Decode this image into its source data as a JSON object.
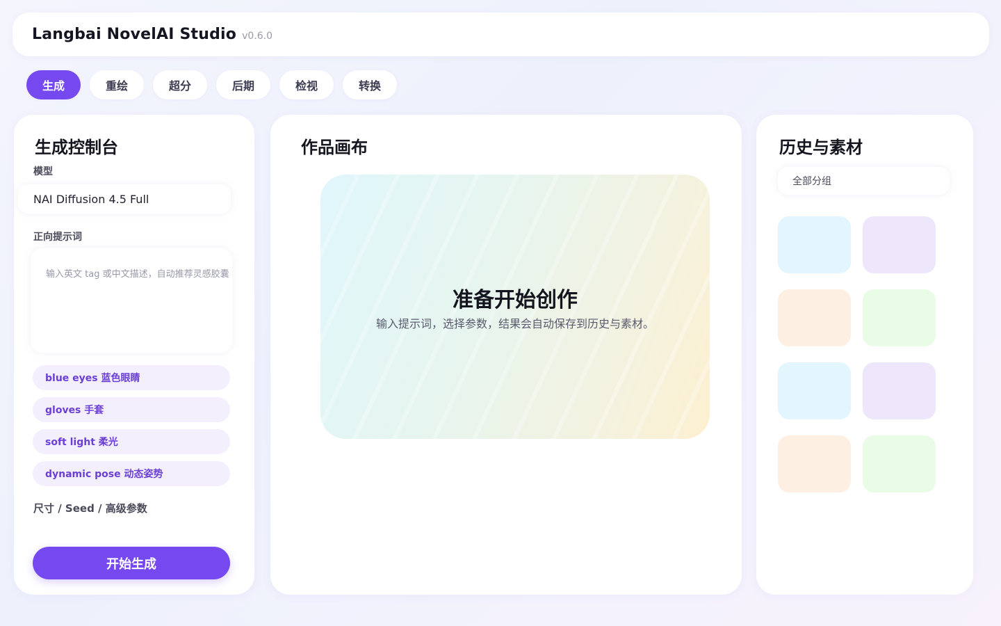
{
  "header": {
    "title": "Langbai NovelAI Studio",
    "version": "v0.6.0"
  },
  "tabs": [
    {
      "label": "生成",
      "active": true
    },
    {
      "label": "重绘"
    },
    {
      "label": "超分"
    },
    {
      "label": "后期"
    },
    {
      "label": "检视"
    },
    {
      "label": "转换"
    }
  ],
  "control": {
    "title": "生成控制台",
    "model_label": "模型",
    "model_value": "NAI Diffusion 4.5 Full",
    "prompt_label": "正向提示词",
    "prompt_placeholder": "输入英文 tag 或中文描述，自动推荐灵感胶囊",
    "chips": [
      "blue  eyes 蓝色眼睛",
      "gloves 手套",
      "soft  light 柔光",
      "dynamic  pose 动态姿势"
    ],
    "advanced_label": "尺寸 / Seed / 高级参数",
    "generate_label": "开始生成"
  },
  "canvas": {
    "title": "作品画布",
    "heading": "准备开始创作",
    "subtitle": "输入提示词，选择参数，结果会自动保存到历史与素材。"
  },
  "history": {
    "title": "历史与素材",
    "group_value": "全部分组",
    "thumb_colors": [
      "#e3f6fd",
      "#eee7fc",
      "#fdf0e3",
      "#e9fce6",
      "#e3f6fd",
      "#eee7fc",
      "#fdf0e3",
      "#e9fce6"
    ]
  },
  "colors": {
    "accent": "#7548f0",
    "chip_bg": "#f3effd",
    "chip_text": "#6b3fd6"
  }
}
